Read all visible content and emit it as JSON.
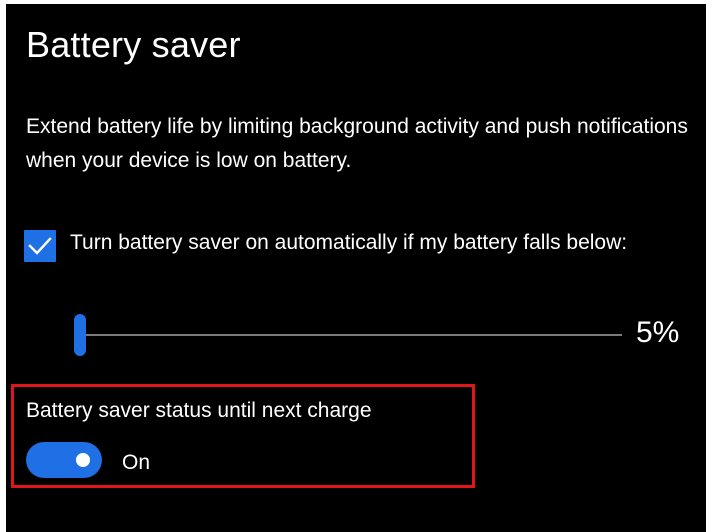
{
  "page": {
    "title": "Battery saver",
    "description": "Extend battery life by limiting background activity and push notifications when your device is low on battery."
  },
  "auto_enable": {
    "checked": true,
    "label": "Turn battery saver on automatically if my battery falls below:"
  },
  "threshold_slider": {
    "value_percent": 5,
    "value_label": "5%"
  },
  "status_section": {
    "label": "Battery saver status until next charge",
    "toggle_on": true,
    "toggle_state_label": "On"
  },
  "icons": {
    "checkbox": "checkmark-icon"
  },
  "colors": {
    "background": "#000000",
    "text": "#ffffff",
    "accent": "#1f6fe5",
    "highlight_border": "#e0161d",
    "slider_track": "#7a7a7a"
  }
}
